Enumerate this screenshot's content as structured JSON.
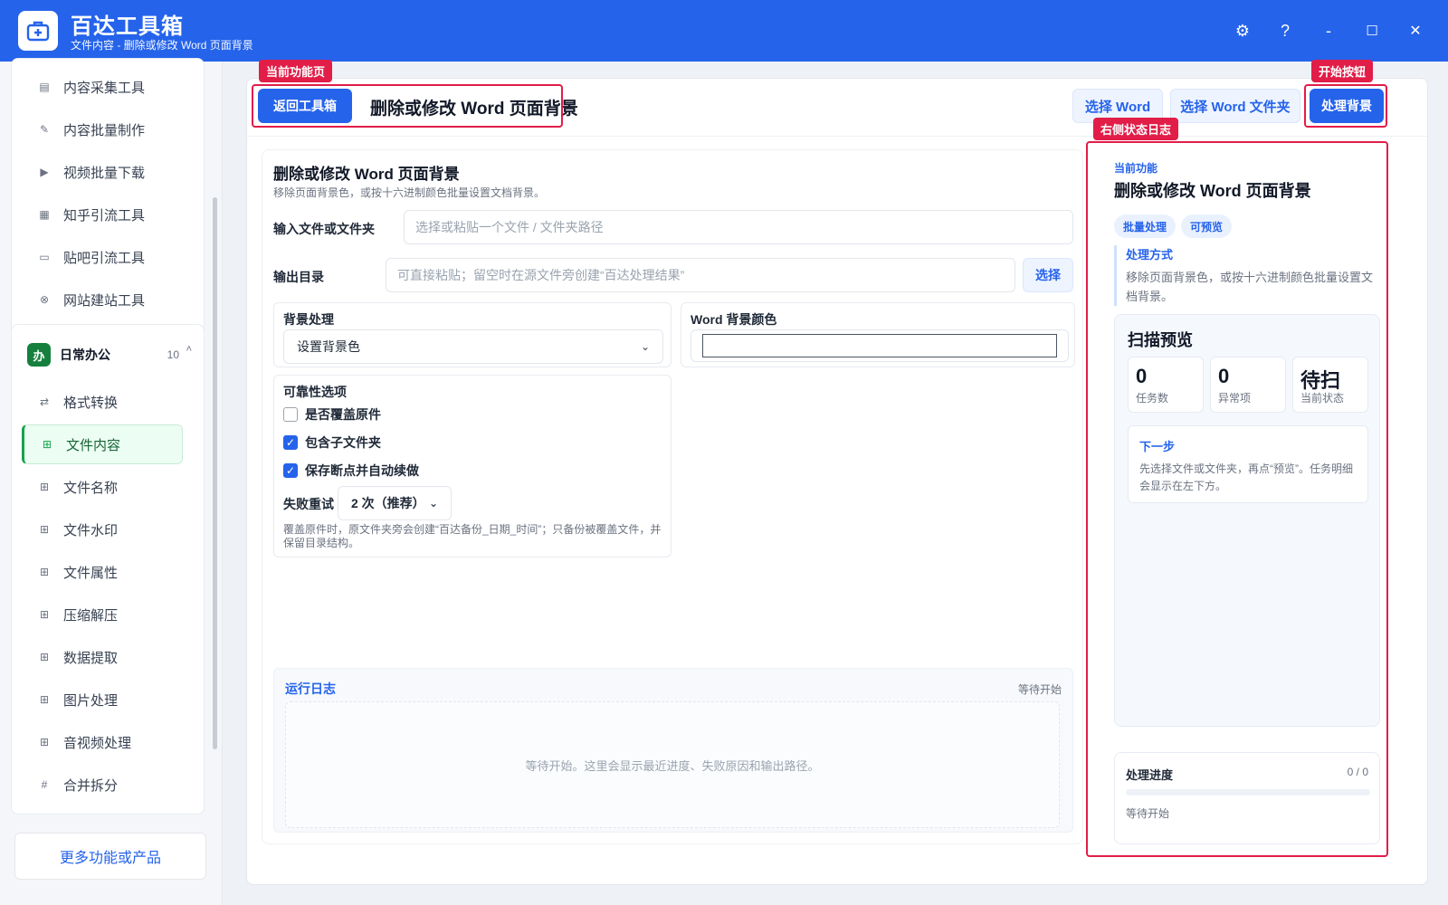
{
  "app": {
    "title": "百达工具箱",
    "subtitle": "文件内容 - 删除或修改 Word 页面背景",
    "controls": {
      "settings": "⚙",
      "help": "?",
      "minimize": "-",
      "maximize": "☐",
      "close": "✕"
    }
  },
  "sidebar": {
    "top_items": [
      {
        "label": "内容采集工具",
        "icon": "clipboard-icon"
      },
      {
        "label": "内容批量制作",
        "icon": "pen-icon"
      },
      {
        "label": "视频批量下载",
        "icon": "video-icon"
      },
      {
        "label": "知乎引流工具",
        "icon": "note-icon"
      },
      {
        "label": "贴吧引流工具",
        "icon": "chat-icon"
      },
      {
        "label": "网站建站工具",
        "icon": "globe-icon"
      }
    ],
    "group": {
      "badge": "办",
      "title": "日常办公",
      "count": "10",
      "chevron": "˄"
    },
    "group_items": [
      {
        "label": "格式转换",
        "icon": "swap-icon"
      },
      {
        "label": "文件内容",
        "icon": "grid-icon",
        "active": true
      },
      {
        "label": "文件名称",
        "icon": "grid-icon"
      },
      {
        "label": "文件水印",
        "icon": "grid-icon"
      },
      {
        "label": "文件属性",
        "icon": "grid-icon"
      },
      {
        "label": "压缩解压",
        "icon": "grid-icon"
      },
      {
        "label": "数据提取",
        "icon": "grid-icon"
      },
      {
        "label": "图片处理",
        "icon": "grid-icon"
      },
      {
        "label": "音视频处理",
        "icon": "grid-icon"
      },
      {
        "label": "合并拆分",
        "icon": "hash-icon"
      }
    ],
    "more_label": "更多功能或产品"
  },
  "toolbar": {
    "back_label": "返回工具箱",
    "page_title": "删除或修改 Word 页面背景",
    "select_word_label": "选择 Word",
    "select_folder_label": "选择 Word 文件夹",
    "process_label": "处理背景"
  },
  "annotations": {
    "current_page": "当前功能页",
    "start_button": "开始按钮",
    "status_log": "右侧状态日志",
    "color": "#e11d48"
  },
  "form": {
    "title": "删除或修改 Word 页面背景",
    "desc": "移除页面背景色，或按十六进制颜色批量设置文档背景。",
    "input_label": "输入文件或文件夹",
    "input_placeholder": "选择或粘贴一个文件 / 文件夹路径",
    "output_label": "输出目录",
    "output_placeholder": "可直接粘贴；留空时在源文件旁创建“百达处理结果”",
    "output_select_label": "选择",
    "bg_label": "背景处理",
    "bg_value": "设置背景色",
    "color_label": "Word 背景颜色",
    "color_value": "",
    "reliability_label": "可靠性选项",
    "options": [
      {
        "label": "是否覆盖原件",
        "checked": false
      },
      {
        "label": "包含子文件夹",
        "checked": true
      },
      {
        "label": "保存断点并自动续做",
        "checked": true
      }
    ],
    "retry_label": "失败重试",
    "retry_value": "2 次（推荐）",
    "note": "覆盖原件时，原文件夹旁会创建“百达备份_日期_时间”；只备份被覆盖文件，并保留目录结构。"
  },
  "log": {
    "title": "运行日志",
    "state": "等待开始",
    "empty": "等待开始。这里会显示最近进度、失败原因和输出路径。"
  },
  "right_panel": {
    "kicker": "当前功能",
    "title": "删除或修改 Word 页面背景",
    "chips": [
      "批量处理",
      "可预览"
    ],
    "method_title": "处理方式",
    "method_desc": "移除页面背景色，或按十六进制颜色批量设置文档背景。",
    "scan_title": "扫描预览",
    "stats": [
      {
        "value": "0",
        "label": "任务数"
      },
      {
        "value": "0",
        "label": "异常项"
      },
      {
        "value": "待扫",
        "label": "当前状态"
      }
    ],
    "next_title": "下一步",
    "next_desc": "先选择文件或文件夹，再点“预览”。任务明细会显示在左下方。",
    "progress_title": "处理进度",
    "progress_count": "0 / 0",
    "progress_value": 0,
    "progress_status": "等待开始"
  },
  "colors": {
    "accent": "#2563eb",
    "active_green": "#16a34a"
  }
}
